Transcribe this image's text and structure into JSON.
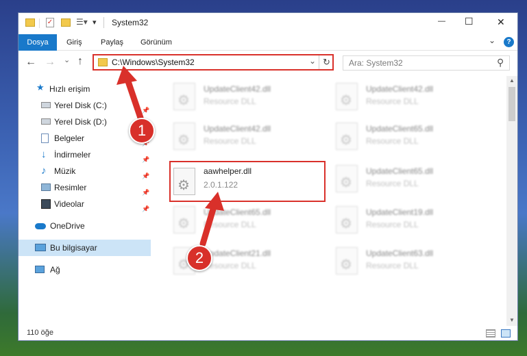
{
  "window": {
    "title": "System32",
    "minimize": "—",
    "maximize": "☐",
    "close": "✕"
  },
  "ribbon": {
    "tabs": [
      "Dosya",
      "Giriş",
      "Paylaş",
      "Görünüm"
    ],
    "expand": "⌄",
    "help": "?"
  },
  "nav": {
    "back": "←",
    "forward": "→",
    "recent": "⌄",
    "up": "↑",
    "address": "C:\\Windows\\System32",
    "address_dropdown": "⌄",
    "refresh": "↻",
    "search_placeholder": "Ara: System32",
    "search_icon": "⚲"
  },
  "sidebar": {
    "items": [
      {
        "label": "Hızlı erişim",
        "icon": "star-icon"
      },
      {
        "label": "Yerel Disk (C:)",
        "icon": "drive-icon"
      },
      {
        "label": "Yerel Disk (D:)",
        "icon": "drive-icon"
      },
      {
        "label": "Belgeler",
        "icon": "document-icon"
      },
      {
        "label": "İndirmeler",
        "icon": "download-icon"
      },
      {
        "label": "Müzik",
        "icon": "music-icon"
      },
      {
        "label": "Resimler",
        "icon": "picture-icon"
      },
      {
        "label": "Videolar",
        "icon": "video-icon"
      },
      {
        "label": "OneDrive",
        "icon": "cloud-icon"
      },
      {
        "label": "Bu bilgisayar",
        "icon": "computer-icon"
      },
      {
        "label": "Ağ",
        "icon": "network-icon"
      }
    ],
    "pin": "📌"
  },
  "files": [
    {
      "name": "UpdateClient42.dll",
      "sub": "Resource DLL"
    },
    {
      "name": "UpdateClient42.dll",
      "sub": "Resource DLL"
    },
    {
      "name": "UpdateClient42.dll",
      "sub": "Resource DLL"
    },
    {
      "name": "UpdateClient65.dll",
      "sub": "Resource DLL"
    },
    {
      "name": "aawhelper.dll",
      "sub": "2.0.1.122"
    },
    {
      "name": "UpdateClient65.dll",
      "sub": "Resource DLL"
    },
    {
      "name": "UpdateClient65.dll",
      "sub": "Resource DLL"
    },
    {
      "name": "UpdateClient19.dll",
      "sub": "Resource DLL"
    },
    {
      "name": "UpdateClient21.dll",
      "sub": "Resource DLL"
    },
    {
      "name": "UpdateClient63.dll",
      "sub": "Resource DLL"
    }
  ],
  "status": {
    "count": "110 öğe"
  },
  "callouts": {
    "one": "1",
    "two": "2"
  },
  "colors": {
    "accent": "#1979ca",
    "highlight": "#d9302a"
  }
}
